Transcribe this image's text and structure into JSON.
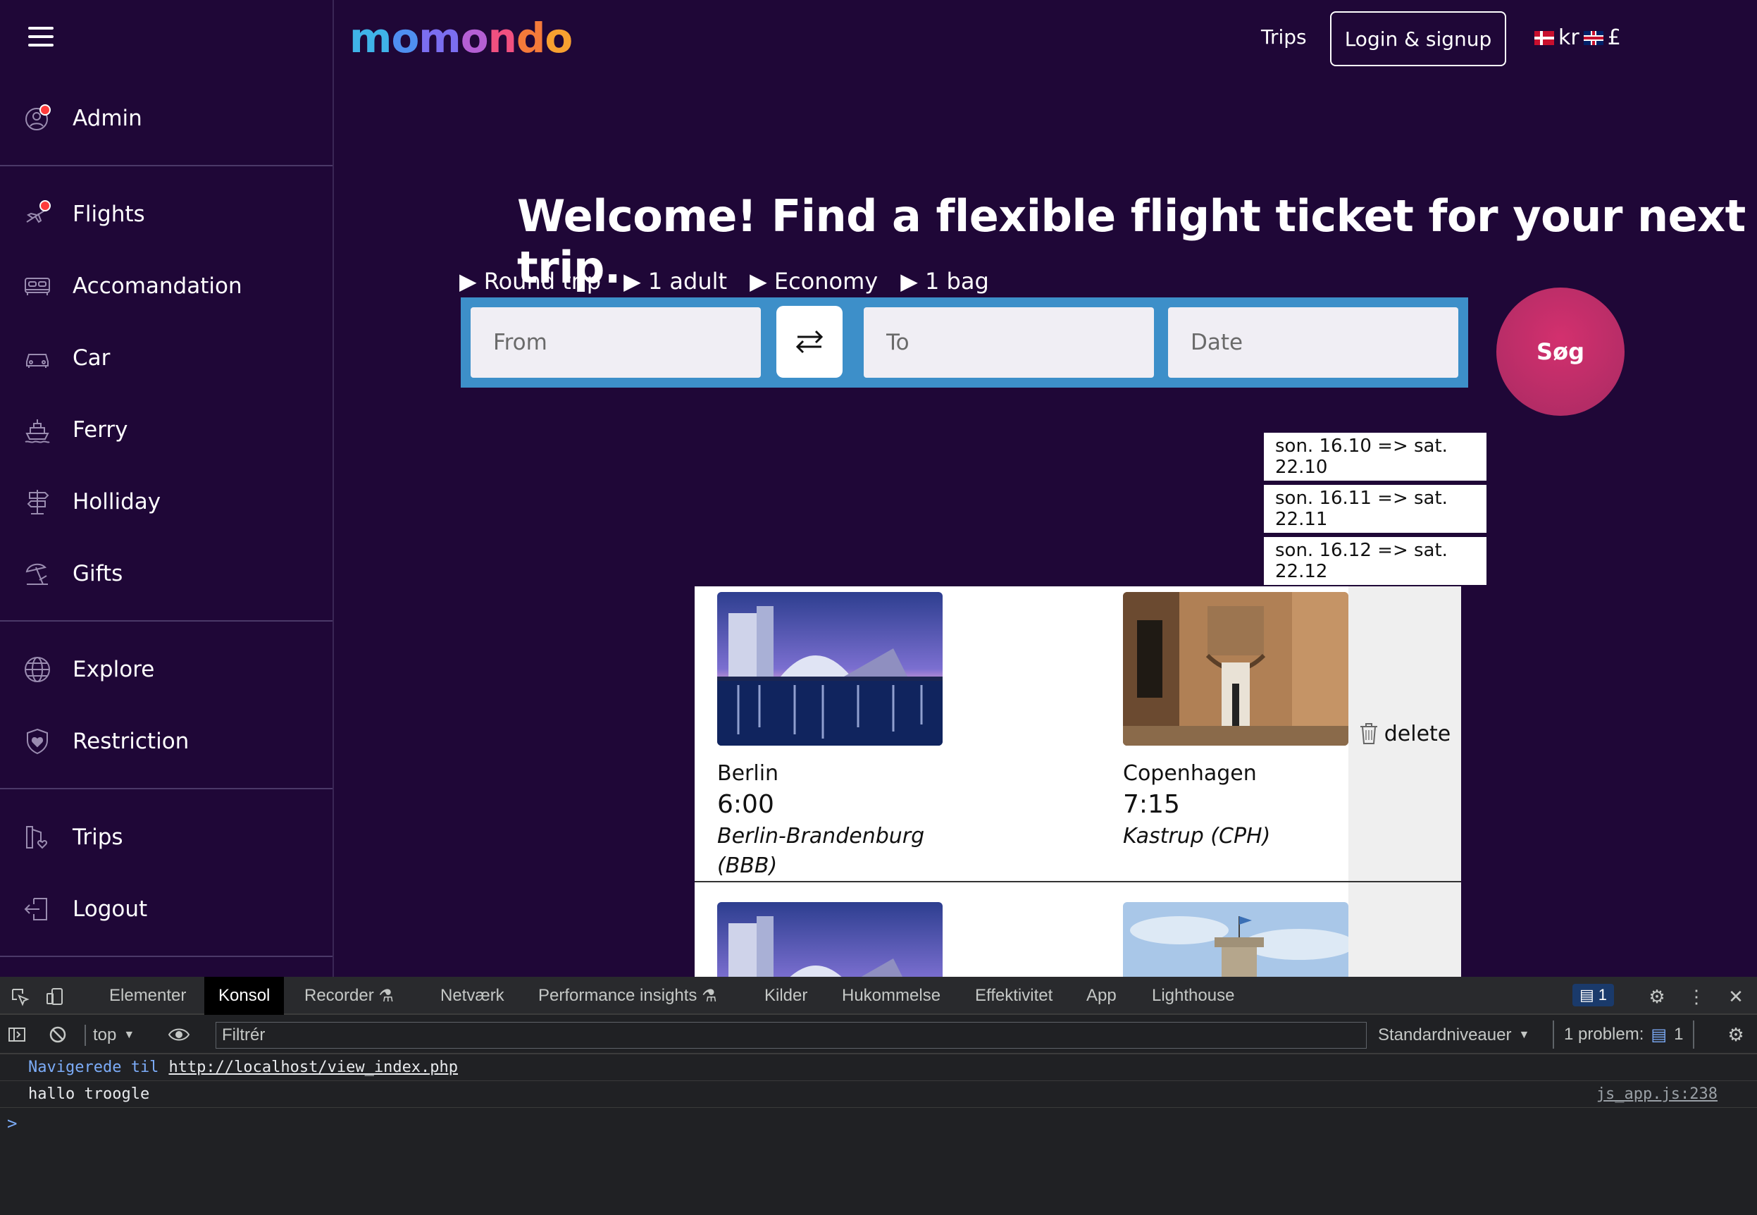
{
  "header": {
    "logo": [
      "m",
      "o",
      "m",
      "o",
      "n",
      "d",
      "o"
    ],
    "logo_colors": [
      "#3fb3e8",
      "#4f8ff0",
      "#7b6ef0",
      "#b45fd4",
      "#f05080",
      "#f57a3a",
      "#f7a030"
    ],
    "trips_link": "Trips",
    "login_button": "Login & signup",
    "currency_dk": "kr",
    "currency_uk": "£"
  },
  "sidebar": {
    "items": [
      {
        "label": "Admin",
        "icon": "admin-icon"
      },
      {
        "label": "Flights",
        "icon": "plane-icon"
      },
      {
        "label": "Accomandation",
        "icon": "bed-icon"
      },
      {
        "label": "Car",
        "icon": "car-icon"
      },
      {
        "label": "Ferry",
        "icon": "ferry-icon"
      },
      {
        "label": "Holliday",
        "icon": "signpost-icon"
      },
      {
        "label": "Gifts",
        "icon": "beach-icon"
      },
      {
        "label": "Explore",
        "icon": "globe-icon"
      },
      {
        "label": "Restriction",
        "icon": "shield-heart-icon"
      },
      {
        "label": "Trips",
        "icon": "trips-icon"
      },
      {
        "label": "Logout",
        "icon": "logout-icon"
      }
    ]
  },
  "hero": {
    "headline": "Welcome! Find a flexible flight ticket for your next trip.",
    "options": [
      "Round trip",
      "1 adult",
      "Economy",
      "1 bag"
    ],
    "from_placeholder": "From",
    "to_placeholder": "To",
    "date_placeholder": "Date",
    "search_button": "Søg"
  },
  "date_suggestions": [
    "son. 16.10 => sat. 22.10",
    "son. 16.11 => sat. 22.11",
    "son. 16.12 => sat. 22.12"
  ],
  "results": [
    {
      "from": {
        "city": "Berlin",
        "time": "6:00",
        "airport": "Berlin-Brandenburg (BBB)"
      },
      "to": {
        "city": "Copenhagen",
        "time": "7:15",
        "airport": "Kastrup (CPH)"
      },
      "delete": "delete"
    }
  ],
  "devtools": {
    "tabs": [
      "Elementer",
      "Konsol",
      "Recorder",
      "Netværk",
      "Performance insights",
      "Kilder",
      "Hukommelse",
      "Effektivitet",
      "App",
      "Lighthouse"
    ],
    "active_tab": "Konsol",
    "issues_count": "1",
    "context": "top",
    "filter_placeholder": "Filtrér",
    "levels": "Standardniveauer",
    "problems_label": "1 problem:",
    "problems_count": "1",
    "nav_prefix": "Navigerede til",
    "nav_url": "http://localhost/view_index.php",
    "log_message": "hallo troogle",
    "log_source": "js_app.js:238",
    "prompt": ">"
  }
}
